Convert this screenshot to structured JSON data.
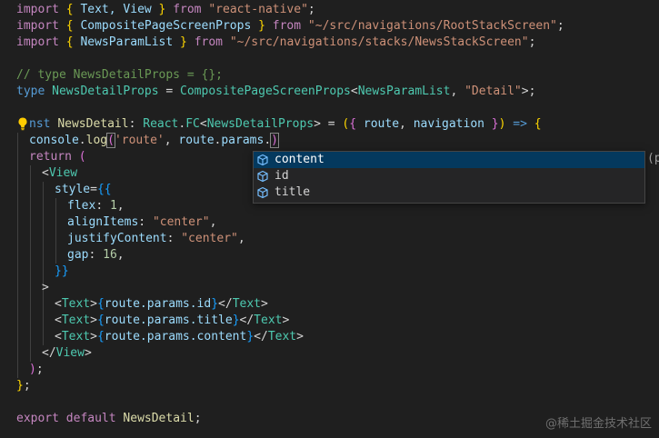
{
  "editor": {
    "lines": {
      "l1": {
        "import": "import",
        "ob": "{",
        "names": " Text, View ",
        "cb": "}",
        "from": "from",
        "mod": "\"react-native\"",
        "semi": ";"
      },
      "l2": {
        "import": "import",
        "ob": "{",
        "names": " CompositePageScreenProps ",
        "cb": "}",
        "from": "from",
        "mod": "\"~/src/navigations/RootStackScreen\"",
        "semi": ";"
      },
      "l3": {
        "import": "import",
        "ob": "{",
        "names": " NewsParamList ",
        "cb": "}",
        "from": "from",
        "mod": "\"~/src/navigations/stacks/NewsStackScreen\"",
        "semi": ";"
      },
      "l5": {
        "comment": "// type NewsDetailProps = {};"
      },
      "l6": {
        "type": "type",
        "name": "NewsDetailProps",
        "eq": " = ",
        "base": "CompositePageScreenProps",
        "lt": "<",
        "arg1": "NewsParamList",
        "comma": ", ",
        "arg2": "\"Detail\"",
        "gt": ">",
        "semi": ";"
      },
      "l8": {
        "const": "nst",
        "name": "NewsDetail",
        "colon": ": ",
        "react": "React",
        "dot": ".",
        "fc": "FC",
        "lt": "<",
        "prop": "NewsDetailProps",
        "gt": ">",
        "eq": " = ",
        "op": "(",
        "ob": "{",
        "route": " route",
        "comma": ", ",
        "nav": "navigation ",
        "cb": "}",
        "cp": ")",
        "arrow": " => ",
        "body": "{"
      },
      "l9": {
        "console": "console",
        "dot": ".",
        "log": "log",
        "op": "(",
        "str": "'route'",
        "comma": ", ",
        "route": "route",
        "d1": ".",
        "params": "params",
        "d2": ".",
        "cp": ")"
      },
      "l10": {
        "ret": "return",
        "paren": " ("
      },
      "l11": {
        "open": "<",
        "tag": "View"
      },
      "l12": {
        "attr": "style",
        "eq": "=",
        "ob": "{{"
      },
      "l13": {
        "key": "flex",
        "colon": ": ",
        "val": "1",
        "comma": ","
      },
      "l14": {
        "key": "alignItems",
        "colon": ": ",
        "val": "\"center\"",
        "comma": ","
      },
      "l15": {
        "key": "justifyContent",
        "colon": ": ",
        "val": "\"center\"",
        "comma": ","
      },
      "l16": {
        "key": "gap",
        "colon": ": ",
        "val": "16",
        "comma": ","
      },
      "l17": {
        "cb": "}}"
      },
      "l18": {
        "gt": ">"
      },
      "l19": {
        "o": "<",
        "tag": "Text",
        "c": ">",
        "ob": "{",
        "expr": "route.params.id",
        "cb": "}",
        "ct": "</",
        "tag2": "Text",
        "c2": ">"
      },
      "l20": {
        "o": "<",
        "tag": "Text",
        "c": ">",
        "ob": "{",
        "expr": "route.params.title",
        "cb": "}",
        "ct": "</",
        "tag2": "Text",
        "c2": ">"
      },
      "l21": {
        "o": "<",
        "tag": "Text",
        "c": ">",
        "ob": "{",
        "expr": "route.params.content",
        "cb": "}",
        "ct": "</",
        "tag2": "Text",
        "c2": ">"
      },
      "l22": {
        "ct": "</",
        "tag": "View",
        "c": ">"
      },
      "l23": {
        "cp": ")",
        "semi": ";"
      },
      "l24": {
        "cb": "}",
        "semi": ";"
      },
      "l26": {
        "export": "export",
        "default": "default",
        "name": "NewsDetail",
        "semi": ";"
      }
    }
  },
  "suggest": {
    "items": [
      "content",
      "id",
      "title"
    ],
    "selected": 0,
    "hint": "(p"
  },
  "watermark": "@稀土掘金技术社区",
  "icons": {
    "bulb": "lightbulb-icon",
    "property": "property-cube-icon"
  },
  "colors": {
    "background": "#1f1f1f",
    "selection": "#04395e",
    "keyword": "#569cd6",
    "string": "#ce9178",
    "type": "#4ec9b0"
  }
}
